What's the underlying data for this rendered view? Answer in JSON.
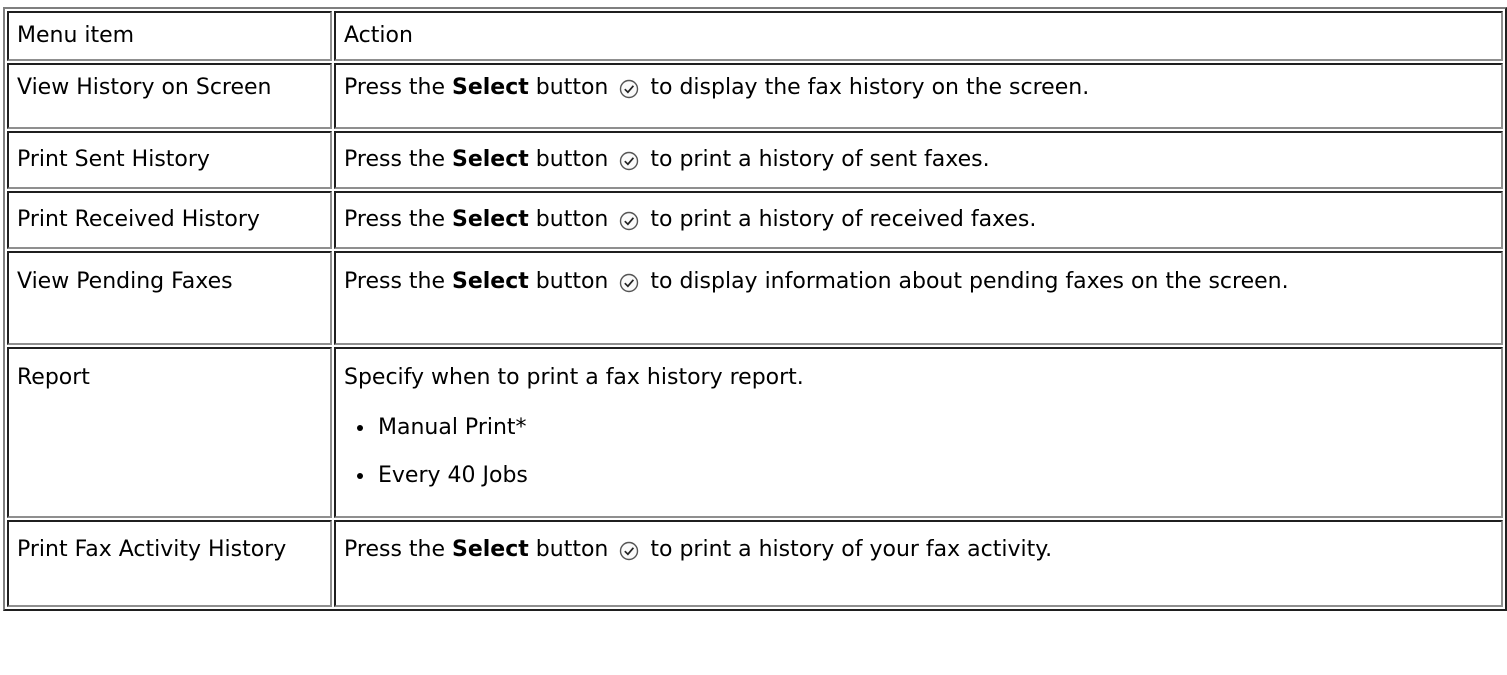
{
  "header": {
    "menu_item": "Menu item",
    "action": "Action"
  },
  "rows": [
    {
      "menu_item": "View History on Screen",
      "prefix": "Press the",
      "bold": "Select",
      "mid": "button",
      "suffix": "to display the fax history on the screen."
    },
    {
      "menu_item": "Print Sent History",
      "prefix": "Press the",
      "bold": "Select",
      "mid": "button",
      "suffix": "to print a history of sent faxes."
    },
    {
      "menu_item": "Print Received History",
      "prefix": "Press the",
      "bold": "Select",
      "mid": "button",
      "suffix": "to print a history of received faxes."
    },
    {
      "menu_item": "View Pending Faxes",
      "prefix": "Press the",
      "bold": "Select",
      "mid": "button",
      "suffix": "to display information about pending faxes on the screen."
    },
    {
      "menu_item": "Report",
      "text": "Specify when to print a fax history report.",
      "options": [
        "Manual Print*",
        "Every 40 Jobs"
      ]
    },
    {
      "menu_item": "Print Fax Activity History",
      "prefix": "Press the",
      "bold": "Select",
      "mid": "button",
      "suffix": "to print a history of your fax activity."
    }
  ],
  "icons": {
    "select": "select-button-icon"
  },
  "colors": {
    "border_dark": "#1f1f1f",
    "border_light": "#8f8f8f"
  }
}
